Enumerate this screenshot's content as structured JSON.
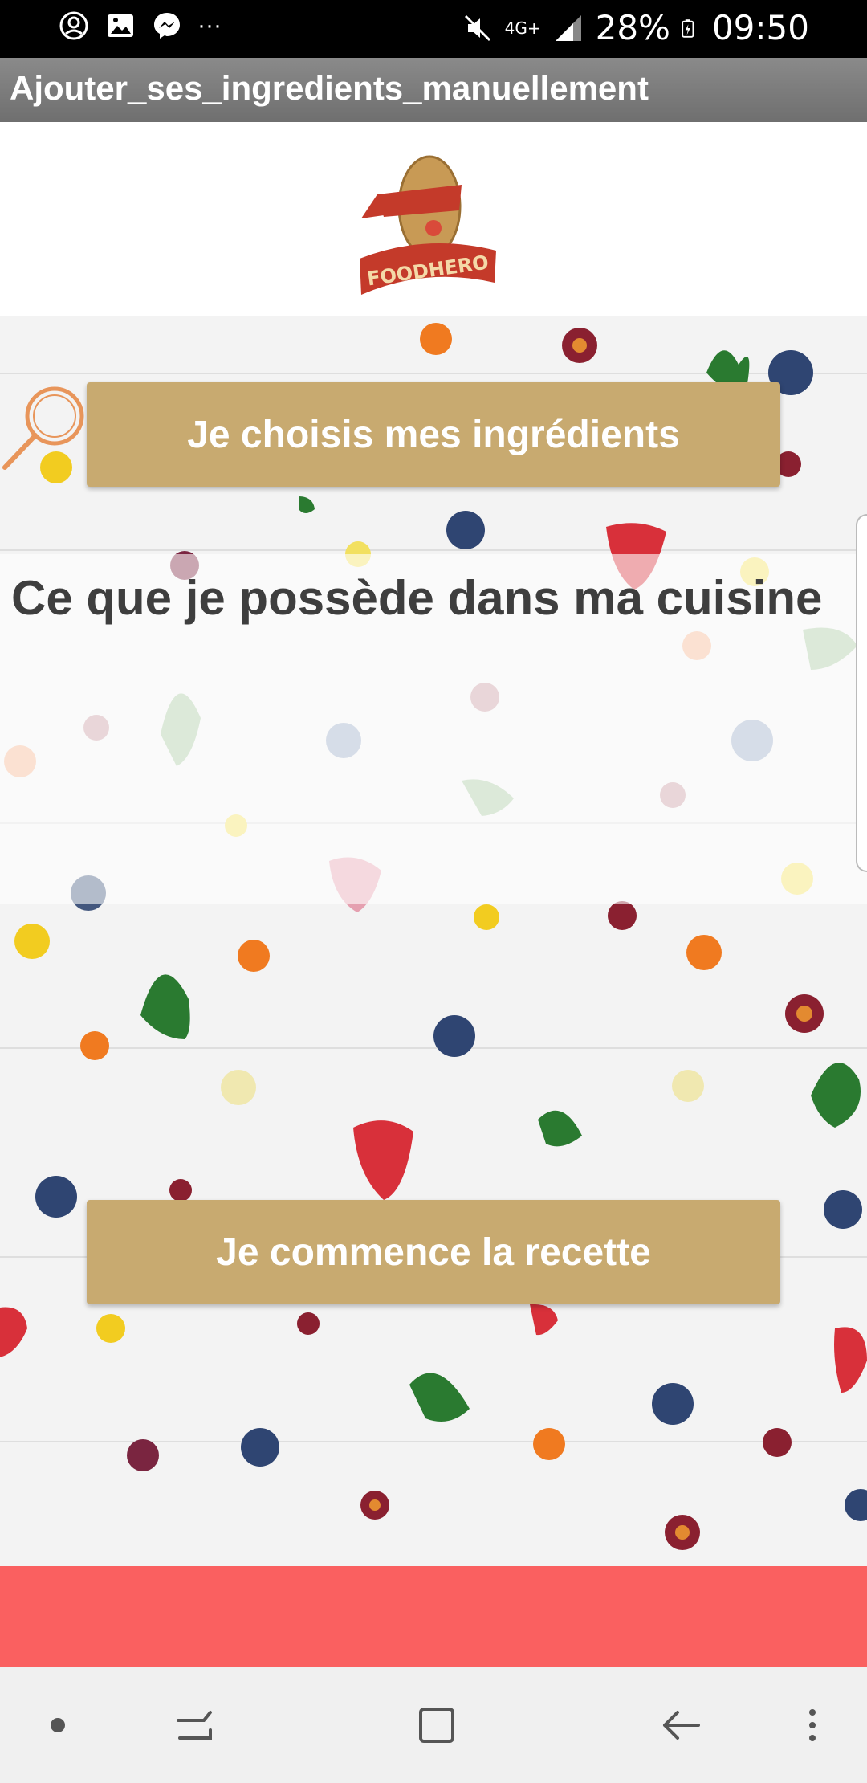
{
  "status_bar": {
    "battery": "28%",
    "time": "09:50",
    "network": "4G+",
    "more_dots": "···"
  },
  "app_bar": {
    "title": "Ajouter_ses_ingredients_manuellement"
  },
  "logo": {
    "text": "FOODHERO"
  },
  "buttons": {
    "choose_ingredients": "Je choisis mes ingrédients",
    "start_recipe": "Je commence la recette"
  },
  "kitchen": {
    "title": "Ce que je possède dans ma cuisine"
  },
  "colors": {
    "button": "#c8aa70",
    "red_band": "#fa6060",
    "app_bar": "#7a7a7a"
  }
}
